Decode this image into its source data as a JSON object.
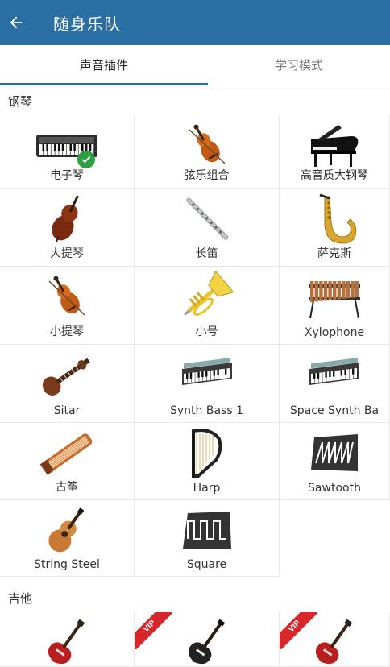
{
  "appbar": {
    "title": "随身乐队",
    "back_icon": "arrow-left-icon"
  },
  "tabs": [
    {
      "label": "声音插件",
      "active": true
    },
    {
      "label": "学习模式",
      "active": false
    }
  ],
  "colors": {
    "primary": "#2a6fa3",
    "check": "#2ea043",
    "vip": "#d9262a"
  },
  "sections": [
    {
      "title": "钢琴",
      "items": [
        {
          "label": "电子琴",
          "icon": "keyboard-icon",
          "selected": true
        },
        {
          "label": "弦乐组合",
          "icon": "violin-icon"
        },
        {
          "label": "高音质大钢琴",
          "icon": "grand-piano-icon"
        },
        {
          "label": "大提琴",
          "icon": "cello-icon"
        },
        {
          "label": "长笛",
          "icon": "flute-icon"
        },
        {
          "label": "萨克斯",
          "icon": "saxophone-icon"
        },
        {
          "label": "小提琴",
          "icon": "violin-icon"
        },
        {
          "label": "小号",
          "icon": "trumpet-icon"
        },
        {
          "label": "Xylophone",
          "icon": "xylophone-icon"
        },
        {
          "label": "Sitar",
          "icon": "sitar-icon"
        },
        {
          "label": "Synth Bass 1",
          "icon": "synth-icon"
        },
        {
          "label": "Space Synth Ba",
          "icon": "synth-icon"
        },
        {
          "label": "古筝",
          "icon": "guzheng-icon"
        },
        {
          "label": "Harp",
          "icon": "harp-icon"
        },
        {
          "label": "Sawtooth",
          "icon": "sawtooth-wave-icon"
        },
        {
          "label": "String Steel",
          "icon": "acoustic-guitar-icon"
        },
        {
          "label": "Square",
          "icon": "square-wave-icon"
        }
      ]
    },
    {
      "title": "吉他",
      "items": [
        {
          "label": "",
          "icon": "electric-guitar-icon",
          "vip": false
        },
        {
          "label": "",
          "icon": "electric-bass-icon",
          "vip": true,
          "badge": "VIP"
        },
        {
          "label": "",
          "icon": "electric-guitar-icon",
          "vip": true,
          "badge": "VIP"
        }
      ]
    }
  ]
}
